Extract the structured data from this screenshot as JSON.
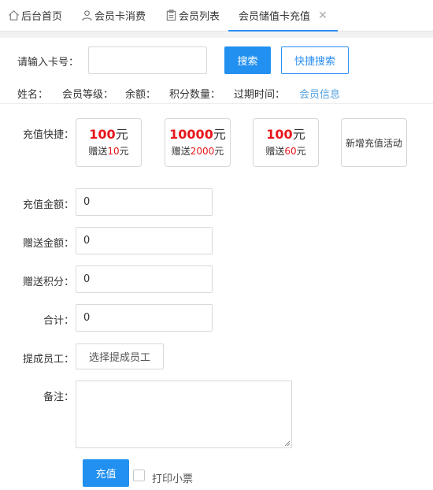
{
  "tabs": [
    {
      "label": "后台首页",
      "icon": "home-icon"
    },
    {
      "label": "会员卡消费",
      "icon": "user-icon"
    },
    {
      "label": "会员列表",
      "icon": "clipboard-icon"
    },
    {
      "label": "会员储值卡充值",
      "icon": null,
      "active": true
    }
  ],
  "search": {
    "label": "请输入卡号：",
    "value": "",
    "search_button": "搜索",
    "quick_button": "快捷搜索"
  },
  "info": {
    "name_label": "姓名：",
    "level_label": "会员等级：",
    "balance_label": "余额：",
    "points_label": "积分数量：",
    "expire_label": "过期时间：",
    "member_link": "会员信息"
  },
  "quick": {
    "label": "充值快捷：",
    "cards": [
      {
        "amount": "100",
        "unit": "元",
        "gift_prefix": "赠送",
        "gift": "10",
        "gift_unit": "元"
      },
      {
        "amount": "10000",
        "unit": "元",
        "gift_prefix": "赠送",
        "gift": "2000",
        "gift_unit": "元"
      },
      {
        "amount": "100",
        "unit": "元",
        "gift_prefix": "赠送",
        "gift": "60",
        "gift_unit": "元"
      }
    ],
    "new_activity": "新增充值活动"
  },
  "form": {
    "amount_label": "充值金额：",
    "amount_value": "0",
    "gift_label": "赠送金额：",
    "gift_value": "0",
    "points_label": "赠送积分：",
    "points_value": "0",
    "total_label": "合计：",
    "total_value": "0",
    "staff_label": "提成员工：",
    "staff_button": "选择提成员工",
    "remark_label": "备注：",
    "remark_value": ""
  },
  "actions": {
    "recharge_button": "充值",
    "print_label": "打印小票",
    "print_checked": false
  },
  "colors": {
    "primary": "#2290f0",
    "highlight_red": "#e8171c",
    "link_blue": "#57a3e0"
  }
}
